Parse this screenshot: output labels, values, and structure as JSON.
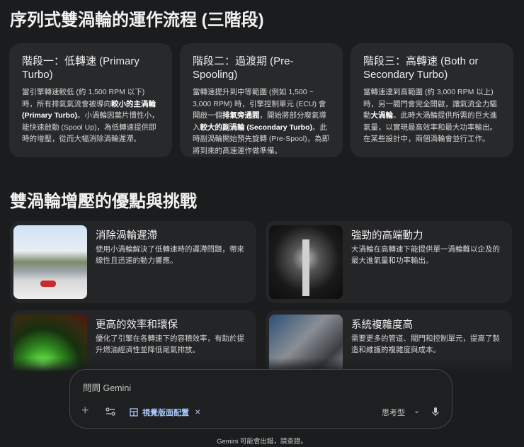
{
  "title": "序列式雙渦輪的運作流程 (三階段)",
  "stages": [
    {
      "title": "階段一：低轉速 (Primary Turbo)",
      "pre": "當引擎轉速較低 (約 1,500 RPM 以下) 時，所有排氣氣流會被導向",
      "b1": "較小的主渦輪 (Primary Turbo)",
      "post": "。小渦輪因葉片慣性小，能快速啟動 (Spool Up)，為低轉速提供即時的增壓，從而大幅消除渦輪遲滯。"
    },
    {
      "title": "階段二：過渡期 (Pre-Spooling)",
      "pre": "當轉速提升到中等範圍 (例如 1,500 ~ 3,000 RPM) 時，引擎控制單元 (ECU) 會開啟一個",
      "b1": "排氣旁通閥",
      "mid": "，開始將部分廢氣導入",
      "b2": "較大的副渦輪 (Secondary Turbo)",
      "post": "。此時副渦輪開始預先旋轉 (Pre-Spool)，為即將到來的高速運作做準備。"
    },
    {
      "title": "階段三：高轉速 (Both or Secondary Turbo)",
      "pre": "當轉速達到高範圍 (約 3,000 RPM 以上) 時，另一閥門會完全開啟，讓氣流全力驅動",
      "b1": "大渦輪",
      "post": "。此時大渦輪提供所需的巨大進氣量，以實現最高效率和最大功率輸出。在某些設計中，兩個渦輪會並行工作。"
    }
  ],
  "section_title": "雙渦輪增壓的優點與挑戰",
  "benefits": [
    {
      "title": "消除渦輪遲滯",
      "desc": "使用小渦輪解決了低轉速時的遲滯問題，帶來線性且迅速的動力響應。"
    },
    {
      "title": "強勁的高端動力",
      "desc": "大渦輪在高轉速下能提供單一渦輪難以企及的最大進氣量和功率輸出。"
    },
    {
      "title": "更高的效率和環保",
      "desc": "優化了引擎在各轉速下的容積效率，有助於提升燃油經濟性並降低尾氣排放。"
    },
    {
      "title": "系統複雜度高",
      "desc": "需要更多的管道、閥門和控制單元，提高了製造和維護的複雜度與成本。"
    }
  ],
  "composer": {
    "placeholder": "問問 Gemini",
    "add": "+",
    "tool_chip": "視覺版面配置",
    "chip_close": "✕",
    "mode": "思考型",
    "chevron": "⌄"
  },
  "footer": "Gemini 可能會出錯，請查證。",
  "colors": {
    "accent": "#a8c7fa"
  }
}
